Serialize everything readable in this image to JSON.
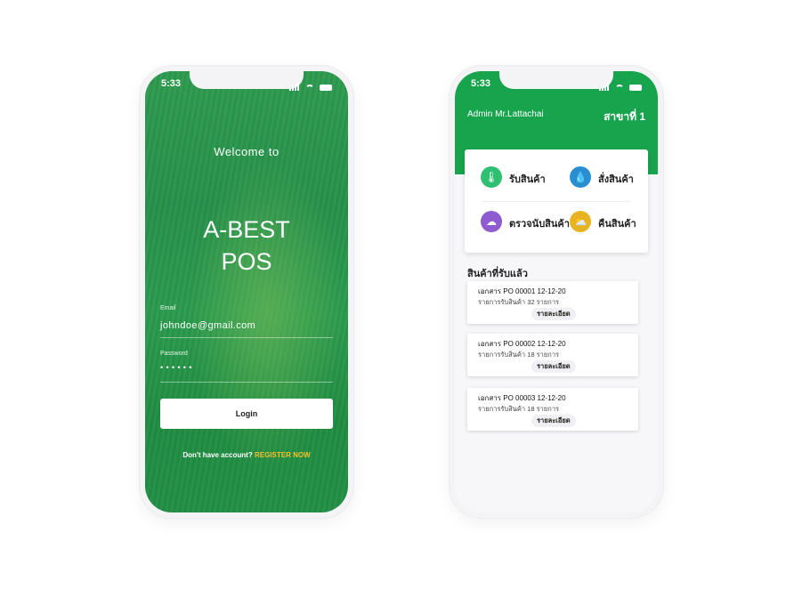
{
  "status_bar": {
    "time": "5:33"
  },
  "login": {
    "welcome": "Welcome to",
    "brand_line1": "A-BEST",
    "brand_line2": "POS",
    "email_label": "Email",
    "email_value": "johndoe@gmail.com",
    "password_label": "Password",
    "password_value": "• • • • • •",
    "login_button": "Login",
    "register_prompt": "Don't have account?",
    "register_link": "REGISTER NOW"
  },
  "admin": {
    "user_label": "Admin  Mr.Lattachai",
    "branch": "สาขาที่ 1",
    "menu": [
      {
        "label": "รับสินค้า",
        "icon": "thermometer-icon",
        "color": "#2fbf71",
        "glyph": "🌡"
      },
      {
        "label": "สั่งสินค้า",
        "icon": "droplet-icon",
        "color": "#2a8fd0",
        "glyph": "💧"
      },
      {
        "label": "ตรวจนับสินค้า",
        "icon": "cloud-snow-icon",
        "color": "#8e5bd0",
        "glyph": "☁"
      },
      {
        "label": "คืนสินค้า",
        "icon": "cloud-sun-icon",
        "color": "#e8b320",
        "glyph": "⛅"
      }
    ],
    "section_title": "สินค้าที่รับแล้ว",
    "documents": [
      {
        "title": "เอกสาร PO 00001 12-12-20",
        "subtitle": "รายการรับสินค้า 32 รายการ",
        "button": "รายละเอียด"
      },
      {
        "title": "เอกสาร PO 00002 12-12-20",
        "subtitle": "รายการรับสินค้า 18 รายการ",
        "button": "รายละเอียด"
      },
      {
        "title": "เอกสาร PO 00003 12-12-20",
        "subtitle": "รายการรับสินค้า 18 รายการ",
        "button": "รายละเอียด"
      }
    ]
  },
  "colors": {
    "primary_green": "#17a44d",
    "accent_yellow": "#f2c12e"
  }
}
